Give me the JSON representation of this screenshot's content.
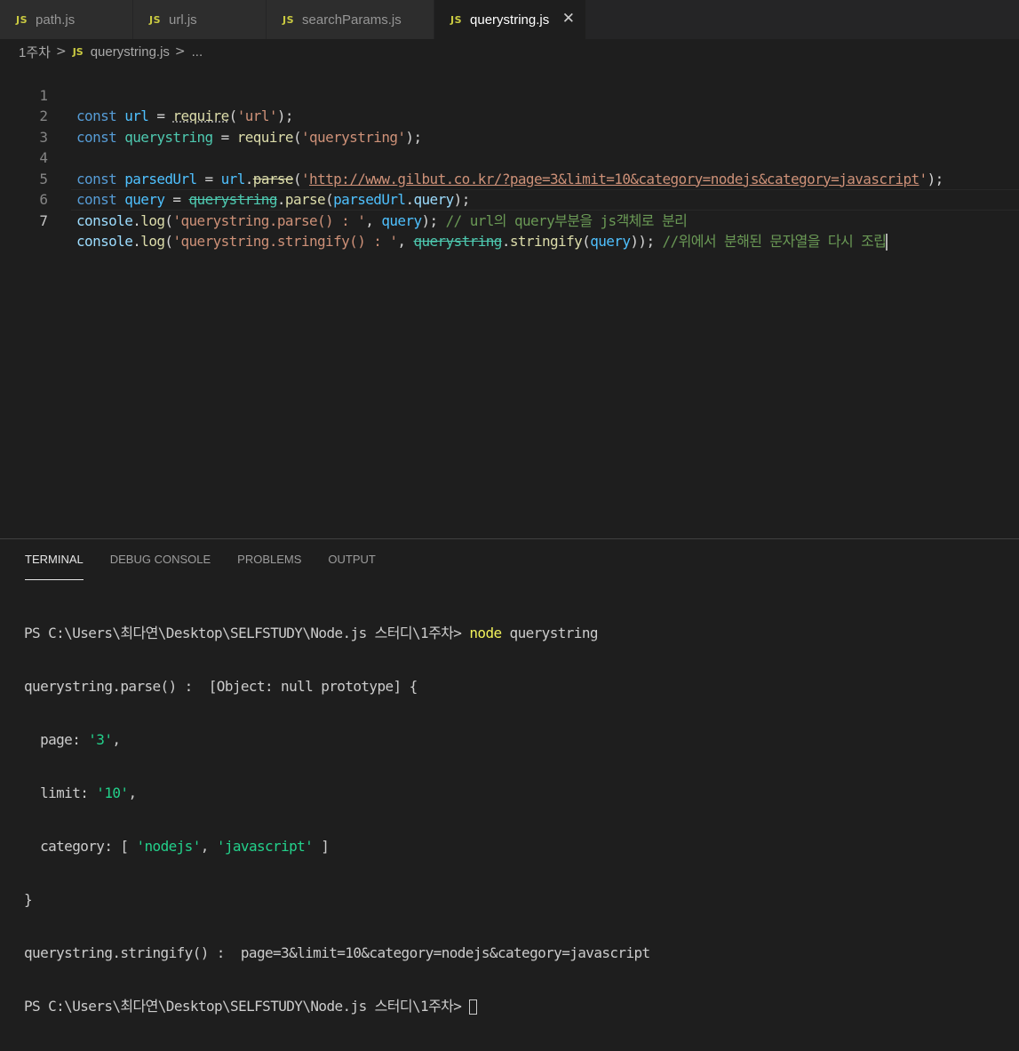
{
  "tabs": [
    {
      "icon": "JS",
      "label": "path.js"
    },
    {
      "icon": "JS",
      "label": "url.js"
    },
    {
      "icon": "JS",
      "label": "searchParams.js"
    },
    {
      "icon": "JS",
      "label": "querystring.js",
      "close": "✕"
    }
  ],
  "breadcrumb": {
    "folder": "1주차",
    "sep": ">",
    "icon": "JS",
    "file": "querystring.js",
    "sep2": ">",
    "tail": "..."
  },
  "editor": {
    "line_numbers": [
      "1",
      "2",
      "3",
      "4",
      "5",
      "6",
      "7"
    ],
    "lines": [
      {
        "t1": "const",
        "t2": " ",
        "t3": "url",
        "t4": " = ",
        "t5": "require",
        "t6": "(",
        "t7": "'url'",
        "t8": ");"
      },
      {
        "t1": "const",
        "t2": " ",
        "t3": "querystring",
        "t4": " = ",
        "t5": "require",
        "t6": "(",
        "t7": "'querystring'",
        "t8": ");"
      },
      {},
      {
        "t1": "const",
        "t2": " ",
        "t3": "parsedUrl",
        "t4": " = ",
        "t5": "url",
        "t6": ".",
        "t7": "parse",
        "t8": "(",
        "t9": "'",
        "t10": "http://www.gilbut.co.kr/?page=3&limit=10&category=nodejs&category=javascript",
        "t11": "'",
        "t12": ");"
      },
      {
        "t1": "const",
        "t2": " ",
        "t3": "query",
        "t4": " = ",
        "t5": "querystring",
        "t6": ".",
        "t7": "parse",
        "t8": "(",
        "t9": "parsedUrl",
        "t10": ".",
        "t11": "query",
        "t12": ");"
      },
      {
        "t1": "console",
        "t2": ".",
        "t3": "log",
        "t4": "(",
        "t5": "'querystring.parse() : '",
        "t6": ", ",
        "t7": "query",
        "t8": "); ",
        "t9": "// url의 query부분을 js객체로 분리"
      },
      {
        "t1": "console",
        "t2": ".",
        "t3": "log",
        "t4": "(",
        "t5": "'querystring.stringify() : '",
        "t6": ", ",
        "t7": "querystring",
        "t8": ".",
        "t9": "stringify",
        "t10": "(",
        "t11": "query",
        "t12": ")); ",
        "t13": "//위에서 분해된 문자열을 다시 조립"
      }
    ]
  },
  "panel": {
    "tabs": [
      "TERMINAL",
      "DEBUG CONSOLE",
      "PROBLEMS",
      "OUTPUT"
    ],
    "terminal": {
      "prompt1": "PS C:\\Users\\최다연\\Desktop\\SELFSTUDY\\Node.js 스터디\\1주차> ",
      "cmd": "node",
      "cmd_arg": " querystring",
      "l2": "querystring.parse() :  [Object: null prototype] {",
      "l3a": "  page: ",
      "l3b": "'3'",
      "l3c": ",",
      "l4a": "  limit: ",
      "l4b": "'10'",
      "l4c": ",",
      "l5a": "  category: [ ",
      "l5b": "'nodejs'",
      "l5c": ", ",
      "l5d": "'javascript'",
      "l5e": " ]",
      "l6": "}",
      "l7a": "querystring.stringify() :  ",
      "l7b": "page=3&limit=10&category=nodejs&category=javascript",
      "prompt2": "PS C:\\Users\\최다연\\Desktop\\SELFSTUDY\\Node.js 스터디\\1주차> "
    }
  }
}
